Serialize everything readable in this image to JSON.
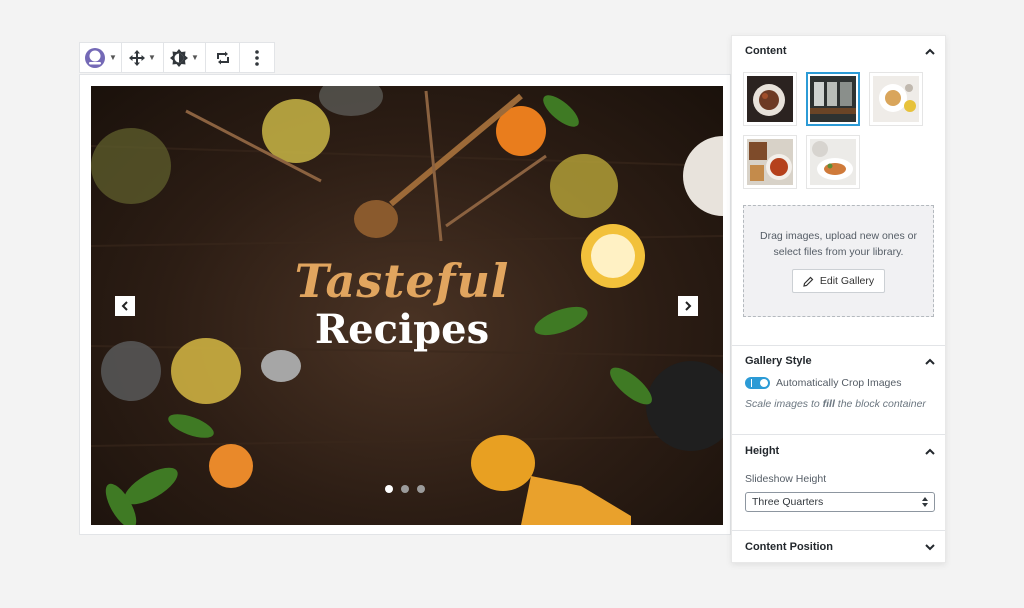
{
  "toolbar": {
    "buttons": [
      {
        "name": "block-style",
        "icon": "circle-avatar-icon"
      },
      {
        "name": "move",
        "icon": "move-arrows-icon"
      },
      {
        "name": "brightness",
        "icon": "brightness-icon"
      },
      {
        "name": "transform",
        "icon": "transform-icon"
      },
      {
        "name": "more",
        "icon": "ellipsis-vertical-icon"
      }
    ]
  },
  "slide": {
    "title_script": "Tasteful",
    "title_main": "Recipes",
    "dots": [
      true,
      false,
      false
    ]
  },
  "panel": {
    "content": {
      "title": "Content",
      "thumbnails": [
        {
          "name": "dish-plate",
          "selected": false
        },
        {
          "name": "restaurant-interior",
          "selected": true
        },
        {
          "name": "table-setting",
          "selected": false
        },
        {
          "name": "pizza-and-snacks",
          "selected": false
        },
        {
          "name": "salad-plate",
          "selected": false
        }
      ],
      "dropzone_text": "Drag images, upload new ones or select files from your library.",
      "edit_gallery_label": "Edit Gallery"
    },
    "gallery_style": {
      "title": "Gallery Style",
      "toggle_label": "Automatically Crop Images",
      "toggle_on": true,
      "help_prefix": "Scale images to ",
      "help_emph": "fill",
      "help_suffix": " the block container"
    },
    "height": {
      "title": "Height",
      "field_label": "Slideshow Height",
      "selected_value": "Three Quarters"
    },
    "content_position": {
      "title": "Content Position"
    }
  },
  "colors": {
    "accent": "#2c9bd6",
    "title_gold": "#e1a55f",
    "toolbar_purple": "#7469b6"
  }
}
